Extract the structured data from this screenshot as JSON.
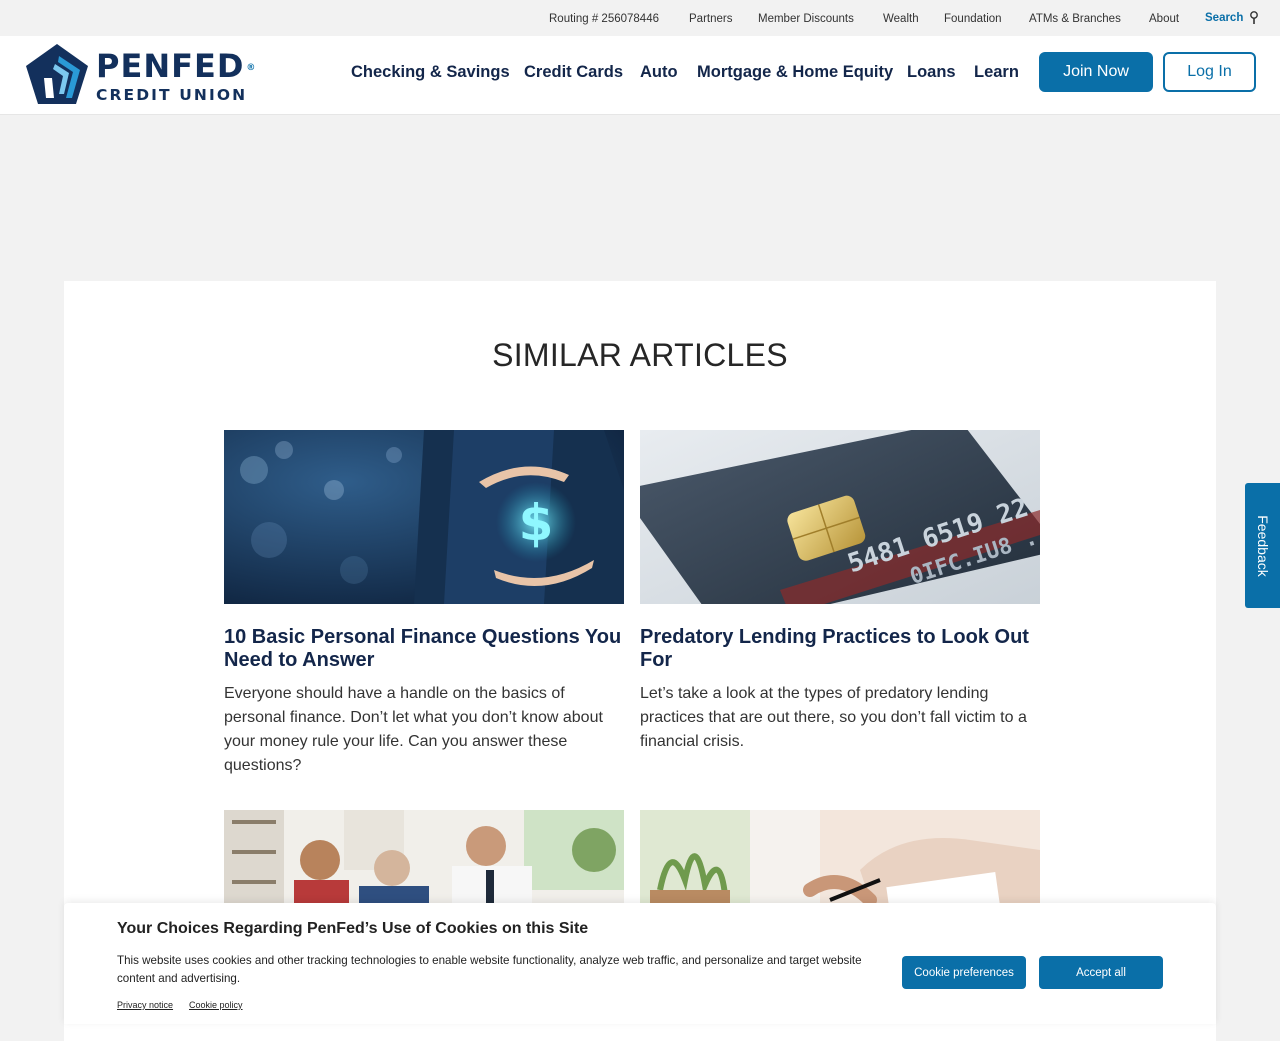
{
  "utility_bar": {
    "routing": "Routing # 256078446",
    "links": [
      "Partners",
      "Member Discounts",
      "Wealth",
      "Foundation",
      "ATMs & Branches",
      "About"
    ],
    "search_label": "Search"
  },
  "header": {
    "logo_top": "PENFED",
    "logo_reg": "®",
    "logo_bottom": "CREDIT UNION",
    "nav": [
      "Checking & Savings",
      "Credit Cards",
      "Auto",
      "Mortgage & Home Equity",
      "Loans",
      "Learn"
    ],
    "join_label": "Join Now",
    "login_label": "Log In"
  },
  "main": {
    "section_title": "SIMILAR ARTICLES",
    "articles": [
      {
        "title": "10 Basic Personal Finance Questions You Need to Answer",
        "description": "Everyone should have a handle on the basics of personal finance. Don’t let what you don’t know about your money rule your life. Can you answer these questions?"
      },
      {
        "title": "Predatory Lending Practices to Look Out For",
        "description": "Let’s take a look at the types of predatory lending practices that are out there, so you don’t fall victim to a financial crisis."
      }
    ]
  },
  "feedback": {
    "label": "Feedback"
  },
  "cookie_banner": {
    "title": "Your Choices Regarding PenFed’s Use of Cookies on this Site",
    "text": "This website uses cookies and other tracking technologies to enable website functionality, analyze web traffic, and personalize and target website content and advertising.",
    "privacy_link": "Privacy notice",
    "cookie_link": "Cookie policy",
    "preferences_button": "Cookie preferences",
    "accept_button": "Accept all"
  },
  "colors": {
    "brand_navy": "#13264a",
    "brand_blue": "#0a6fa8",
    "page_bg": "#f2f2f2"
  },
  "icons": {
    "search": "search-icon",
    "logo": "pentagon-logo-icon"
  }
}
